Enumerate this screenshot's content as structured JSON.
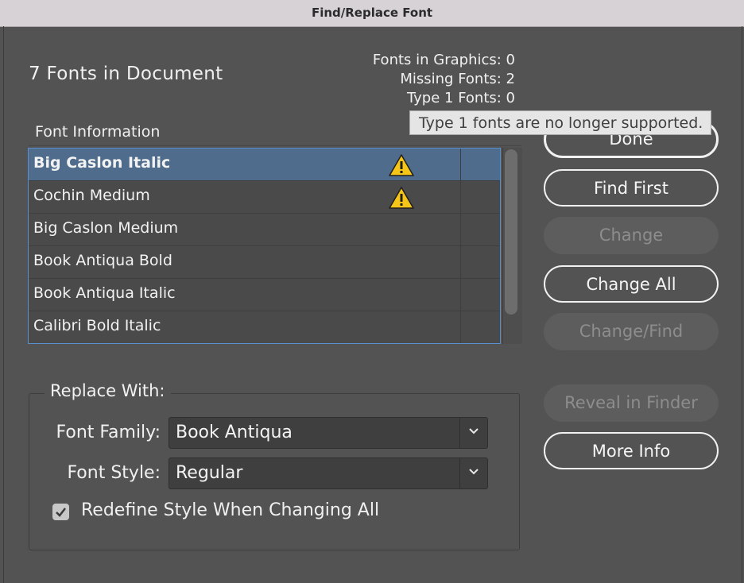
{
  "window": {
    "title": "Find/Replace Font"
  },
  "summary": {
    "heading": "7 Fonts in Document",
    "fonts_in_graphics": "Fonts in Graphics: 0",
    "missing_fonts": "Missing Fonts: 2",
    "type1_fonts": "Type 1 Fonts: 0"
  },
  "tooltip": {
    "text": "Type 1 fonts are no longer supported."
  },
  "font_list": {
    "header": "Font Information",
    "rows": [
      {
        "name": "Big Caslon Italic",
        "warning": true,
        "selected": true
      },
      {
        "name": "Cochin Medium",
        "warning": true,
        "selected": false
      },
      {
        "name": "Big Caslon Medium",
        "warning": false,
        "selected": false
      },
      {
        "name": "Book Antiqua Bold",
        "warning": false,
        "selected": false
      },
      {
        "name": "Book Antiqua Italic",
        "warning": false,
        "selected": false
      },
      {
        "name": "Calibri Bold Italic",
        "warning": false,
        "selected": false
      }
    ]
  },
  "buttons": {
    "done": "Done",
    "find_first": "Find First",
    "change": "Change",
    "change_all": "Change All",
    "change_find": "Change/Find",
    "reveal_in_finder": "Reveal in Finder",
    "more_info": "More Info"
  },
  "replace_with": {
    "title": "Replace With:",
    "font_family_label": "Font Family:",
    "font_family_value": "Book Antiqua",
    "font_style_label": "Font Style:",
    "font_style_value": "Regular",
    "redefine_label": "Redefine Style When Changing All",
    "redefine_checked": true
  },
  "colors": {
    "selection": "#4f6c8c",
    "list_border": "#5a8fcf",
    "warning": "#f5c518"
  }
}
